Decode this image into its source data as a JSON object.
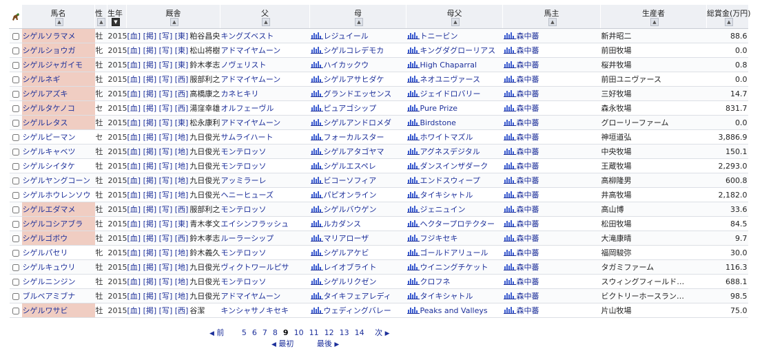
{
  "headers": {
    "name": "馬名",
    "sex": "性",
    "year": "生年",
    "trainer": "厩舎",
    "sire": "父",
    "dam": "母",
    "damsire": "母父",
    "owner": "馬主",
    "breeder": "生産者",
    "prize": "総賞金(万円)"
  },
  "sort_symbol": "▲",
  "sort_active_symbol": "▼",
  "rows": [
    {
      "name": "シゲルソラマメ",
      "hl": true,
      "sex": "牡",
      "year": "2015",
      "tags": "[血] [掲] [写] [東]",
      "trainer": "粕谷昌央",
      "sire": "キングズベスト",
      "dam": "レジュイール",
      "damsire": "トニービン",
      "owner": "森中蕃",
      "breeder": "新井昭二",
      "prize": "88.6"
    },
    {
      "name": "シゲルショウガ",
      "hl": true,
      "sex": "牝",
      "year": "2015",
      "tags": "[血] [掲] [写] [東]",
      "trainer": "松山将樹",
      "sire": "アドマイヤムーン",
      "dam": "シゲルコレデモカ",
      "damsire": "キングダグローリアス",
      "owner": "森中蕃",
      "breeder": "前田牧場",
      "prize": "0.0"
    },
    {
      "name": "シゲルジャガイモ",
      "hl": true,
      "sex": "牡",
      "year": "2015",
      "tags": "[血] [掲] [写] [東]",
      "trainer": "鈴木孝志",
      "sire": "ノヴェリスト",
      "dam": "ハイカックウ",
      "damsire": "High Chaparral",
      "owner": "森中蕃",
      "breeder": "桜井牧場",
      "prize": "0.8"
    },
    {
      "name": "シゲルネギ",
      "hl": true,
      "sex": "牡",
      "year": "2015",
      "tags": "[血] [掲] [写] [西]",
      "trainer": "服部利之",
      "sire": "アドマイヤムーン",
      "dam": "シゲルアサヒダケ",
      "damsire": "ネオユニヴァース",
      "owner": "森中蕃",
      "breeder": "前田ユニヴァース",
      "prize": "0.0"
    },
    {
      "name": "シゲルアズキ",
      "hl": true,
      "sex": "牝",
      "year": "2015",
      "tags": "[血] [掲] [写] [西]",
      "trainer": "高橋康之",
      "sire": "カネヒキリ",
      "dam": "グランドエッセンス",
      "damsire": "ジェイドロバリー",
      "owner": "森中蕃",
      "breeder": "三好牧場",
      "prize": "14.7"
    },
    {
      "name": "シゲルタケノコ",
      "hl": true,
      "sex": "セ",
      "year": "2015",
      "tags": "[血] [掲] [写] [西]",
      "trainer": "湯窪幸雄",
      "sire": "オルフェーヴル",
      "dam": "ピュアゴシップ",
      "damsire": "Pure Prize",
      "owner": "森中蕃",
      "breeder": "森永牧場",
      "prize": "831.7"
    },
    {
      "name": "シゲルレタス",
      "hl": true,
      "sex": "牡",
      "year": "2015",
      "tags": "[血] [掲] [写] [東]",
      "trainer": "松永康利",
      "sire": "アドマイヤムーン",
      "dam": "シゲルアンドロメダ",
      "damsire": "Birdstone",
      "owner": "森中蕃",
      "breeder": "グローリーファーム",
      "prize": "0.0"
    },
    {
      "name": "シゲルピーマン",
      "hl": false,
      "sex": "セ",
      "year": "2015",
      "tags": "[血] [掲] [写] [地]",
      "trainer": "九日俊光",
      "sire": "サムライハート",
      "dam": "フォーカルスター",
      "damsire": "ホワイトマズル",
      "owner": "森中蕃",
      "breeder": "神垣道弘",
      "prize": "3,886.9"
    },
    {
      "name": "シゲルキャベツ",
      "hl": false,
      "sex": "牡",
      "year": "2015",
      "tags": "[血] [掲] [写] [地]",
      "trainer": "九日俊光",
      "sire": "モンテロッソ",
      "dam": "シゲルアタゴヤマ",
      "damsire": "アグネスデジタル",
      "owner": "森中蕃",
      "breeder": "中央牧場",
      "prize": "150.1"
    },
    {
      "name": "シゲルシイタケ",
      "hl": false,
      "sex": "牡",
      "year": "2015",
      "tags": "[血] [掲] [写] [地]",
      "trainer": "九日俊光",
      "sire": "モンテロッソ",
      "dam": "シゲルエスペレ",
      "damsire": "ダンスインザダーク",
      "owner": "森中蕃",
      "breeder": "王蔵牧場",
      "prize": "2,293.0"
    },
    {
      "name": "シゲルヤングコーン",
      "hl": false,
      "sex": "牡",
      "year": "2015",
      "tags": "[血] [掲] [写] [地]",
      "trainer": "九日俊光",
      "sire": "アッミラーレ",
      "dam": "ビコーソフィア",
      "damsire": "エンドスウィープ",
      "owner": "森中蕃",
      "breeder": "高柳隆男",
      "prize": "600.8"
    },
    {
      "name": "シゲルホウレンソウ",
      "hl": false,
      "sex": "牡",
      "year": "2015",
      "tags": "[血] [掲] [写] [地]",
      "trainer": "九日俊光",
      "sire": "ヘニーヒューズ",
      "dam": "パピオンライン",
      "damsire": "タイキシャトル",
      "owner": "森中蕃",
      "breeder": "井高牧場",
      "prize": "2,182.0"
    },
    {
      "name": "シゲルエダマメ",
      "hl": true,
      "sex": "牡",
      "year": "2015",
      "tags": "[血] [掲] [写] [西]",
      "trainer": "服部利之",
      "sire": "モンテロッソ",
      "dam": "シゲルバウゲン",
      "damsire": "ジェニュイン",
      "owner": "森中蕃",
      "breeder": "高山博",
      "prize": "33.6"
    },
    {
      "name": "シゲルコシアブラ",
      "hl": true,
      "sex": "牡",
      "year": "2015",
      "tags": "[血] [掲] [写] [東]",
      "trainer": "青木孝文",
      "sire": "エイシンフラッシュ",
      "dam": "ルカダンス",
      "damsire": "ヘクタープロテクター",
      "owner": "森中蕃",
      "breeder": "松田牧場",
      "prize": "84.5"
    },
    {
      "name": "シゲルゴボウ",
      "hl": true,
      "sex": "牡",
      "year": "2015",
      "tags": "[血] [掲] [写] [西]",
      "trainer": "鈴木孝志",
      "sire": "ルーラーシップ",
      "dam": "マリアローザ",
      "damsire": "フジキセキ",
      "owner": "森中蕃",
      "breeder": "大滝康晴",
      "prize": "9.7"
    },
    {
      "name": "シゲルパセリ",
      "hl": false,
      "sex": "牝",
      "year": "2015",
      "tags": "[血] [掲] [写] [地]",
      "trainer": "鈴木義久",
      "sire": "モンテロッソ",
      "dam": "シゲルアケビ",
      "damsire": "ゴールドアリュール",
      "owner": "森中蕃",
      "breeder": "福岡駿弥",
      "prize": "30.0"
    },
    {
      "name": "シゲルキュウリ",
      "hl": false,
      "sex": "牡",
      "year": "2015",
      "tags": "[血] [掲] [写] [地]",
      "trainer": "九日俊光",
      "sire": "ヴィクトワールピサ",
      "dam": "レイオブライト",
      "damsire": "ウイニングチケット",
      "owner": "森中蕃",
      "breeder": "タガミファーム",
      "prize": "116.3"
    },
    {
      "name": "シゲルニンジン",
      "hl": false,
      "sex": "牡",
      "year": "2015",
      "tags": "[血] [掲] [写] [地]",
      "trainer": "九日俊光",
      "sire": "モンテロッソ",
      "dam": "シゲルリクゼン",
      "damsire": "クロフネ",
      "owner": "森中蕃",
      "breeder": "スウィングフィールド…",
      "prize": "688.1"
    },
    {
      "name": "ブルベアミブナ",
      "hl": false,
      "sex": "牡",
      "year": "2015",
      "tags": "[血] [掲] [写] [地]",
      "trainer": "九日俊光",
      "sire": "アドマイヤムーン",
      "dam": "タイキフェアレディ",
      "damsire": "タイキシャトル",
      "owner": "森中蕃",
      "breeder": "ビクトリーホースラン…",
      "prize": "98.5"
    },
    {
      "name": "シゲルワサビ",
      "hl": true,
      "sex": "牡",
      "year": "2015",
      "tags": "[血] [掲] [写] [西]",
      "trainer": "谷潔",
      "sire": "キンシャサノキセキ",
      "dam": "ウェディングバレー",
      "damsire": "Peaks and Valleys",
      "owner": "森中蕃",
      "breeder": "片山牧場",
      "prize": "75.0"
    }
  ],
  "pager": {
    "prev": "前",
    "next": "次",
    "first": "最初",
    "last": "最後",
    "pages": [
      "5",
      "6",
      "7",
      "8",
      "9",
      "10",
      "11",
      "12",
      "13",
      "14"
    ],
    "current": "9"
  }
}
